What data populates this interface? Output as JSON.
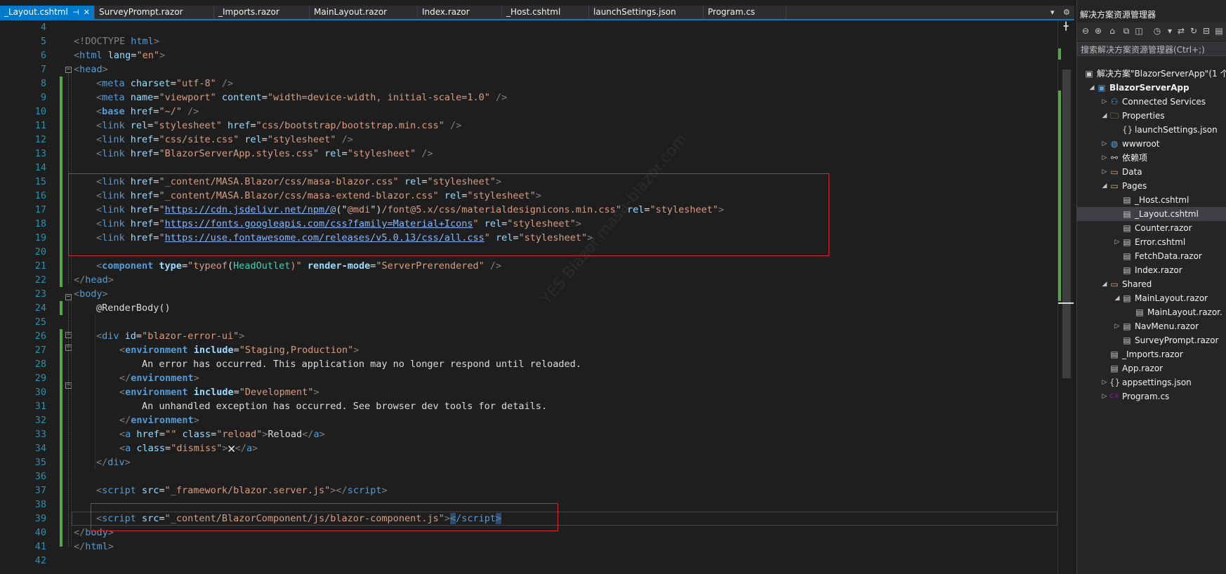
{
  "tabs": [
    {
      "label": "_Layout.cshtml",
      "active": true
    },
    {
      "label": "SurveyPrompt.razor"
    },
    {
      "label": "_Imports.razor"
    },
    {
      "label": "MainLayout.razor"
    },
    {
      "label": "Index.razor"
    },
    {
      "label": "_Host.cshtml"
    },
    {
      "label": "launchSettings.json"
    },
    {
      "label": "Program.cs"
    }
  ],
  "tab_icons": {
    "pin": "pin-icon",
    "close": "close-icon",
    "overflow": "chevron-down-icon",
    "settings": "gear-icon"
  },
  "colors": {
    "accent": "#007acc",
    "added_line": "#57a64a",
    "highlight_box": "#d3262f",
    "line_number": "#2b91af"
  },
  "watermark": "YES Blazor.masa-blazor.com",
  "line_numbers": [
    "4",
    "5",
    "6",
    "7",
    "8",
    "9",
    "10",
    "11",
    "12",
    "13",
    "14",
    "15",
    "16",
    "17",
    "18",
    "19",
    "20",
    "21",
    "22",
    "23",
    "24",
    "25",
    "26",
    "27",
    "28",
    "29",
    "30",
    "31",
    "32",
    "33",
    "34",
    "35",
    "36",
    "37",
    "38",
    "39",
    "40",
    "41",
    "42"
  ],
  "code": {
    "l5": [
      "<!DOCTYPE ",
      "html",
      ">"
    ],
    "l6": [
      "<",
      "html ",
      "lang",
      "=",
      "\"en\"",
      ">"
    ],
    "l7": [
      "<",
      "head",
      ">"
    ],
    "l8": [
      "<",
      "meta ",
      "charset",
      "=",
      "\"utf-8\"",
      " />"
    ],
    "l9": [
      "<",
      "meta ",
      "name",
      "=",
      "\"viewport\"",
      " ",
      "content",
      "=",
      "\"width=device-width, initial-scale=1.0\"",
      " />"
    ],
    "l10": [
      "<",
      "base ",
      "href",
      "=",
      "\"~/\"",
      " />"
    ],
    "l11": [
      "<",
      "link ",
      "rel",
      "=",
      "\"stylesheet\"",
      " ",
      "href",
      "=",
      "\"css/bootstrap/bootstrap.min.css\"",
      " />"
    ],
    "l12": [
      "<",
      "link ",
      "href",
      "=",
      "\"css/site.css\"",
      " ",
      "rel",
      "=",
      "\"stylesheet\"",
      " />"
    ],
    "l13": [
      "<",
      "link ",
      "href",
      "=",
      "\"BlazorServerApp.styles.css\"",
      " ",
      "rel",
      "=",
      "\"stylesheet\"",
      " />"
    ],
    "l15": [
      "<",
      "link ",
      "href",
      "=",
      "\"_content/MASA.Blazor/css/masa-blazor.css\"",
      " ",
      "rel",
      "=",
      "\"stylesheet\"",
      ">"
    ],
    "l16": [
      "<",
      "link ",
      "href",
      "=",
      "\"_content/MASA.Blazor/css/masa-extend-blazor.css\"",
      " ",
      "rel",
      "=",
      "\"stylesheet\"",
      ">"
    ],
    "l17": [
      "<",
      "link ",
      "href",
      "=",
      "\"",
      "https://cdn.jsdelivr.net/npm/@",
      "(\"",
      "@mdi",
      "\")",
      "/font@5.x/css/materialdesignicons.min.css\"",
      " ",
      "rel",
      "=",
      "\"stylesheet\"",
      ">"
    ],
    "l18": [
      "<",
      "link ",
      "href",
      "=",
      "\"",
      "https://fonts.googleapis.com/css?family=Material+Icons",
      "\"",
      " ",
      "rel",
      "=",
      "\"stylesheet\"",
      ">"
    ],
    "l19": [
      "<",
      "link ",
      "href",
      "=",
      "\"",
      "https://use.fontawesome.com/releases/v5.0.13/css/all.css",
      "\"",
      " ",
      "rel",
      "=",
      "\"stylesheet\"",
      ">"
    ],
    "l21": [
      "<",
      "component ",
      "type",
      "=",
      "\"typeof",
      "(",
      "HeadOutlet",
      ")\"",
      " ",
      "render-mode",
      "=",
      "\"ServerPrerendered\"",
      " />"
    ],
    "l22": [
      "</",
      "head",
      ">"
    ],
    "l23": [
      "<",
      "body",
      ">"
    ],
    "l24": [
      "@RenderBody()"
    ],
    "l26": [
      "<",
      "div ",
      "id",
      "=",
      "\"blazor-error-ui\"",
      ">"
    ],
    "l27": [
      "<",
      "environment ",
      "include",
      "=",
      "\"Staging,Production\"",
      ">"
    ],
    "l28": [
      "An error has occurred. This application may no longer respond until reloaded."
    ],
    "l29": [
      "</",
      "environment",
      ">"
    ],
    "l30": [
      "<",
      "environment ",
      "include",
      "=",
      "\"Development\"",
      ">"
    ],
    "l31": [
      "An unhandled exception has occurred. See browser dev tools for details."
    ],
    "l32": [
      "</",
      "environment",
      ">"
    ],
    "l33": [
      "<",
      "a ",
      "href",
      "=",
      "\"\"",
      " ",
      "class",
      "=",
      "\"reload\"",
      ">",
      "Reload",
      "</",
      "a",
      ">"
    ],
    "l34": [
      "<",
      "a ",
      "class",
      "=",
      "\"dismiss\"",
      ">",
      "🗙",
      "</",
      "a",
      ">"
    ],
    "l35": [
      "</",
      "div",
      ">"
    ],
    "l37": [
      "<",
      "script ",
      "src",
      "=",
      "\"_framework/blazor.server.js\"",
      ">",
      "</",
      "script",
      ">"
    ],
    "l39": [
      "<",
      "script ",
      "src",
      "=",
      "\"_content/BlazorComponent/js/blazor-component.js\"",
      ">",
      "<",
      "/script",
      ">"
    ],
    "l40": [
      "</",
      "body",
      ">"
    ],
    "l41": [
      "</",
      "html",
      ">"
    ]
  },
  "solution_explorer": {
    "title": "解决方案资源管理器",
    "search_placeholder": "搜索解决方案资源管理器(Ctrl+;)",
    "toolbar_icons": [
      "back-icon",
      "forward-icon",
      "home-icon",
      "vs-icon",
      "history-icon",
      "sync-icon",
      "refresh-icon",
      "collapse-icon",
      "properties-icon"
    ],
    "items": [
      {
        "label": "解决方案\"BlazorServerApp\"(1 个",
        "icon": "solution-icon",
        "level": 0
      },
      {
        "label": "BlazorServerApp",
        "icon": "project-icon",
        "level": 1,
        "expanded": true,
        "bold": true
      },
      {
        "label": "Connected Services",
        "icon": "connected-services-icon",
        "level": 2,
        "expanded": false
      },
      {
        "label": "Properties",
        "icon": "folder-properties-icon",
        "level": 2,
        "expanded": true
      },
      {
        "label": "launchSettings.json",
        "icon": "json-icon",
        "level": 3
      },
      {
        "label": "wwwroot",
        "icon": "globe-icon",
        "level": 2,
        "expanded": false
      },
      {
        "label": "依赖项",
        "icon": "dependencies-icon",
        "level": 2,
        "expanded": false
      },
      {
        "label": "Data",
        "icon": "folder-icon",
        "level": 2,
        "expanded": false
      },
      {
        "label": "Pages",
        "icon": "folder-open-icon",
        "level": 2,
        "expanded": true
      },
      {
        "label": "_Host.cshtml",
        "icon": "cshtml-icon",
        "level": 3
      },
      {
        "label": "_Layout.cshtml",
        "icon": "cshtml-icon",
        "level": 3,
        "selected": true
      },
      {
        "label": "Counter.razor",
        "icon": "razor-icon",
        "level": 3
      },
      {
        "label": "Error.cshtml",
        "icon": "cshtml-icon",
        "level": 3,
        "expanded": false
      },
      {
        "label": "FetchData.razor",
        "icon": "razor-icon",
        "level": 3
      },
      {
        "label": "Index.razor",
        "icon": "razor-icon",
        "level": 3
      },
      {
        "label": "Shared",
        "icon": "folder-open-icon",
        "level": 2,
        "expanded": true
      },
      {
        "label": "MainLayout.razor",
        "icon": "razor-icon",
        "level": 3,
        "expanded": true
      },
      {
        "label": "MainLayout.razor.",
        "icon": "css-icon",
        "level": 4
      },
      {
        "label": "NavMenu.razor",
        "icon": "razor-icon",
        "level": 3,
        "expanded": false
      },
      {
        "label": "SurveyPrompt.razor",
        "icon": "razor-icon",
        "level": 3
      },
      {
        "label": "_Imports.razor",
        "icon": "razor-icon",
        "level": 2
      },
      {
        "label": "App.razor",
        "icon": "razor-icon",
        "level": 2
      },
      {
        "label": "appsettings.json",
        "icon": "json-icon",
        "level": 2,
        "expanded": false
      },
      {
        "label": "Program.cs",
        "icon": "csharp-icon",
        "level": 2,
        "expanded": false
      }
    ]
  }
}
